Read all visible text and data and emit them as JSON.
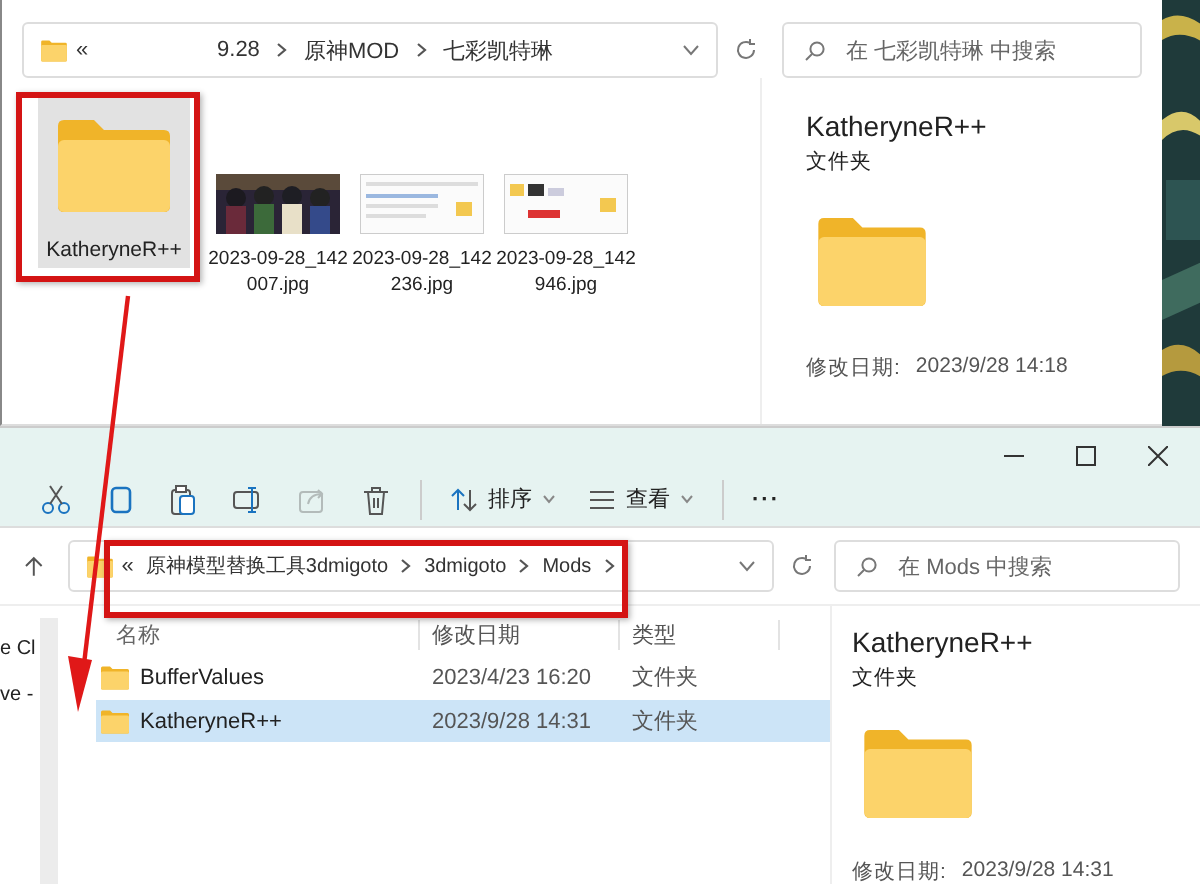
{
  "top_window": {
    "address": {
      "collapsed": "«",
      "path": [
        "9.28",
        "原神MOD",
        "七彩凯特琳"
      ]
    },
    "search": {
      "placeholder": "在 七彩凯特琳 中搜索"
    },
    "items": [
      {
        "name": "KatheryneR++",
        "kind": "folder",
        "selected": true
      },
      {
        "name": "2023-09-28_142007.jpg",
        "selected": false
      },
      {
        "name": "2023-09-28_142236.jpg",
        "kind": "screenshot",
        "selected": false
      },
      {
        "name": "2023-09-28_142946.jpg",
        "kind": "annotated",
        "selected": false
      }
    ],
    "details": {
      "title": "KatheryneR++",
      "type": "文件夹",
      "date_label": "修改日期:",
      "date": "2023/9/28 14:18"
    }
  },
  "bottom_window": {
    "toolbar": [
      {
        "kind": "cut",
        "disabled": false
      },
      {
        "kind": "copy",
        "disabled": false
      },
      {
        "kind": "paste",
        "disabled": false
      },
      {
        "kind": "rename",
        "disabled": false
      },
      {
        "kind": "share",
        "disabled": true
      },
      {
        "kind": "delete",
        "disabled": false
      },
      {
        "kind": "sort",
        "label": "排序",
        "disabled": false
      },
      {
        "kind": "view",
        "label": "查看",
        "disabled": false
      },
      {
        "kind": "more",
        "label": "···",
        "disabled": false
      }
    ],
    "nav_items": [
      "e Cl",
      "ve -"
    ],
    "address": {
      "collapsed": "«",
      "path": [
        "原神模型替换工具3dmigoto",
        "3dmigoto",
        "Mods"
      ]
    },
    "search": {
      "placeholder": "在 Mods 中搜索"
    },
    "columns": [
      "名称",
      "修改日期",
      "类型"
    ],
    "rows": [
      {
        "name": "BufferValues",
        "date": "2023/4/23 16:20",
        "type": "文件夹",
        "selected": false
      },
      {
        "name": "KatheryneR++",
        "date": "2023/9/28 14:31",
        "type": "文件夹",
        "selected": true
      }
    ],
    "details": {
      "title": "KatheryneR++",
      "type": "文件夹",
      "date_label": "修改日期:",
      "date": "2023/9/28 14:31"
    }
  }
}
